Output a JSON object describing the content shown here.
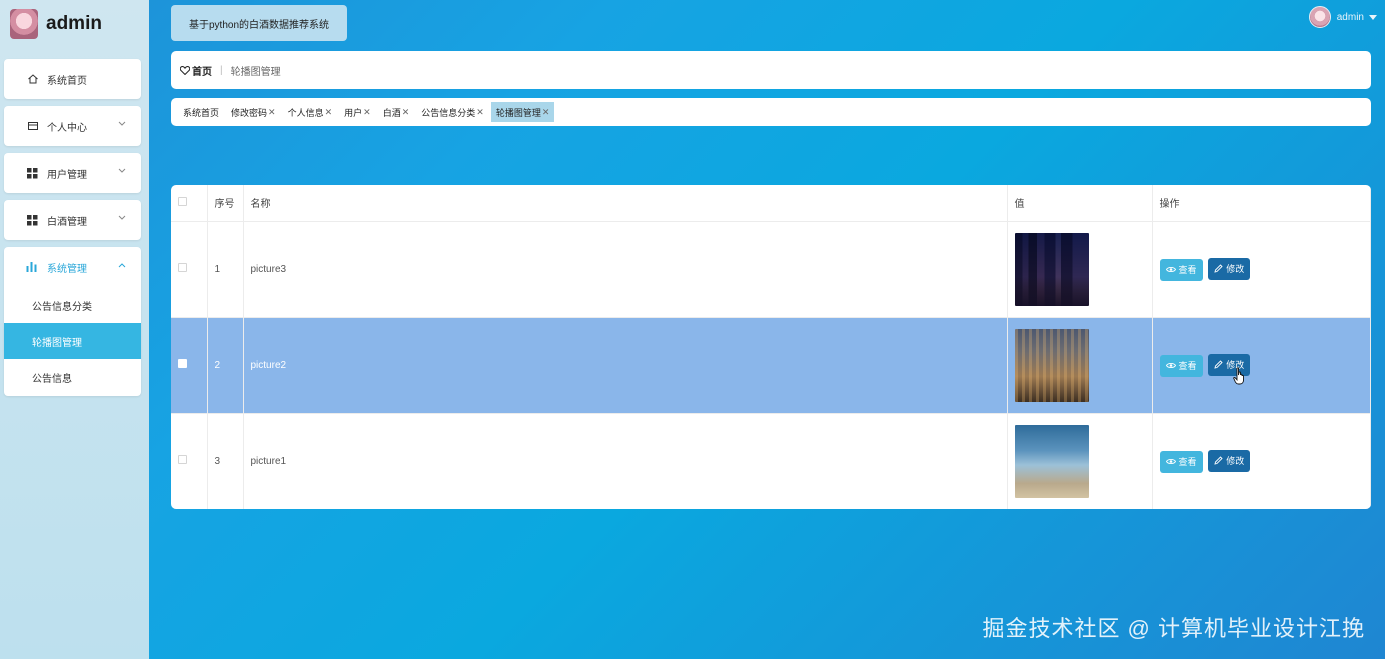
{
  "brand": {
    "title": "admin"
  },
  "sidebar": {
    "items": [
      {
        "label": "系统首页",
        "icon": "home-icon"
      },
      {
        "label": "个人中心",
        "icon": "card-icon",
        "expandable": true
      },
      {
        "label": "用户管理",
        "icon": "grid-icon",
        "expandable": true
      },
      {
        "label": "白酒管理",
        "icon": "grid-icon",
        "expandable": true
      }
    ],
    "open_group": {
      "label": "系统管理",
      "icon": "bar-chart-icon",
      "children": [
        {
          "label": "公告信息分类"
        },
        {
          "label": "轮播图管理",
          "active": true
        },
        {
          "label": "公告信息"
        }
      ]
    }
  },
  "header": {
    "system_title": "基于python的白酒数据推荐系统",
    "user_name": "admin"
  },
  "breadcrumb": {
    "home": "首页",
    "separator": "|",
    "current": "轮播图管理"
  },
  "tabs": [
    {
      "label": "系统首页",
      "closable": false
    },
    {
      "label": "修改密码",
      "closable": true
    },
    {
      "label": "个人信息",
      "closable": true
    },
    {
      "label": "用户",
      "closable": true
    },
    {
      "label": "白酒",
      "closable": true
    },
    {
      "label": "公告信息分类",
      "closable": true
    },
    {
      "label": "轮播图管理",
      "closable": true,
      "active": true
    }
  ],
  "table": {
    "columns": [
      "序号",
      "名称",
      "值",
      "操作"
    ],
    "rows": [
      {
        "index": "1",
        "name": "picture3",
        "selected": false
      },
      {
        "index": "2",
        "name": "picture2",
        "selected": true
      },
      {
        "index": "3",
        "name": "picture1",
        "selected": false
      }
    ],
    "view_label": "查看",
    "edit_label": "修改"
  },
  "watermark": "掘金技术社区 @ 计算机毕业设计江挽",
  "colors": {
    "accent": "#35b6e2",
    "view_button": "#43b6de",
    "edit_button": "#1a6aa5",
    "selected_row": "#8ab6ea"
  }
}
